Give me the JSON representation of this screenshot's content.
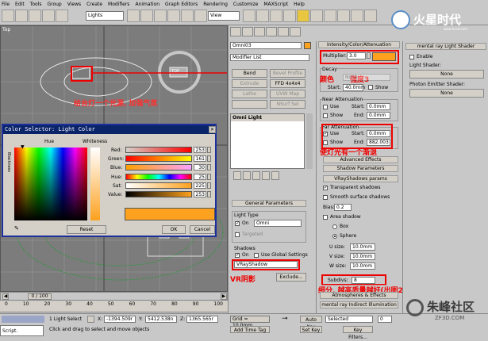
{
  "menubar": [
    "File",
    "Edit",
    "Tools",
    "Group",
    "Views",
    "Create",
    "Modifiers",
    "Animation",
    "Graph Editors",
    "Rendering",
    "Customize",
    "MAXScript",
    "Help"
  ],
  "toolbar": {
    "selection_filter": "Lights",
    "ref_coord": "View"
  },
  "watermark": {
    "brand": "火星时代",
    "site": "www.hxsd.com"
  },
  "viewport": {
    "label": "Top",
    "cube_label": "TOP",
    "annotation": "给台灯一个光源, 加强气氛"
  },
  "color_selector": {
    "title": "Color Selector: Light Color",
    "hue_label": "Hue",
    "whiteness_label": "Whiteness",
    "blackness_label": "Blackness",
    "channels": [
      {
        "name": "Red:",
        "value": "253"
      },
      {
        "name": "Green:",
        "value": "161"
      },
      {
        "name": "Blue:",
        "value": "30"
      },
      {
        "name": "Hue:",
        "value": "25"
      },
      {
        "name": "Sat:",
        "value": "225"
      },
      {
        "name": "Value:",
        "value": "253"
      }
    ],
    "swatch_color": "#fda11e",
    "reset": "Reset",
    "ok": "OK",
    "cancel": "Cancel"
  },
  "command_panel": {
    "object_name": "Omni03",
    "modifier_list": "Modifier List",
    "buttons": [
      "Bend",
      "Bevel Profile",
      "Extrude",
      "FFD 4x4x4",
      "Lathe",
      "UVW Map",
      "",
      "NSurf Sel"
    ],
    "stack_item": "Omni Light",
    "general_params": "General Parameters",
    "light_type": "Light Type",
    "on": "On",
    "light_type_value": "Omni",
    "targeted": "Targeted",
    "shadows": "Shadows",
    "use_global": "Use Global Settings",
    "shadow_type": "VRayShadow",
    "exclude": "Exclude...",
    "annotation_vr": "VR阴影"
  },
  "intensity": {
    "header": "Intensity/Color/Attenuation",
    "multiplier_label": "Multiplier:",
    "multiplier": "3.0",
    "color": "#fda11e",
    "decay": "Decay",
    "type_label": "Type:",
    "type_value": "None",
    "start_label": "Start:",
    "start_value": "40.0mm",
    "show": "Show",
    "annotation_color": "颜色",
    "annotation_strength": "强度3",
    "near_atten": "Near Attenuation",
    "use": "Use",
    "near_start": "0.0mm",
    "near_end": "0.0mm",
    "end_label": "End:",
    "far_atten": "Far Attenuation",
    "far_start": "0.0mm",
    "far_end": "882.003",
    "annotation_far": "使灯光有一个渐退",
    "advanced_effects": "Advanced Effects",
    "shadow_params": "Shadow Parameters",
    "vray_shadows": "VRayShadows params",
    "transparent": "Transparent shadows",
    "smooth": "Smooth surface shadows",
    "bias_label": "Bias:",
    "bias": "0.2",
    "area_shadow": "Area shadow",
    "box": "Box",
    "sphere": "Sphere",
    "u_label": "U size:",
    "v_label": "V size:",
    "w_label": "W size:",
    "u": "10.0mm",
    "v": "10.0mm",
    "w": "10.0mm",
    "subdivs_label": "Subdivs:",
    "subdivs": "8",
    "annotation_subdivs": "细分, 越高质量越好(出图20)",
    "atmos": "Atmospheres & Effects",
    "indirect": "mental ray Indirect Illumination"
  },
  "mental_ray": {
    "header": "mental ray Light Shader",
    "enable": "Enable",
    "light_shader": "Light Shader:",
    "none1": "None",
    "photon_shader": "Photon Emitter Shader:",
    "none2": "None"
  },
  "timeline": {
    "range": "0 / 100",
    "ticks": [
      "0",
      "10",
      "20",
      "30",
      "40",
      "50",
      "60",
      "70",
      "80",
      "90",
      "100"
    ]
  },
  "status": {
    "selection": "1 Light Select",
    "x_label": "X:",
    "x": "-1394.509r",
    "y_label": "Y:",
    "y": "5412.538n",
    "z_label": "Z:",
    "z": "1365.565r",
    "grid": "Grid = 10.0mm",
    "auto_key": "Auto Key",
    "selected": "Selected",
    "set_key": "Set Key",
    "key_filters": "Key Filters...",
    "frame": "0",
    "prompt": "Click and drag to select and move objects",
    "add_time_tag": "Add Time Tag",
    "script": "Script."
  },
  "watermark_bottom": {
    "name": "朱峰社区",
    "site": "ZF3D.COM"
  }
}
